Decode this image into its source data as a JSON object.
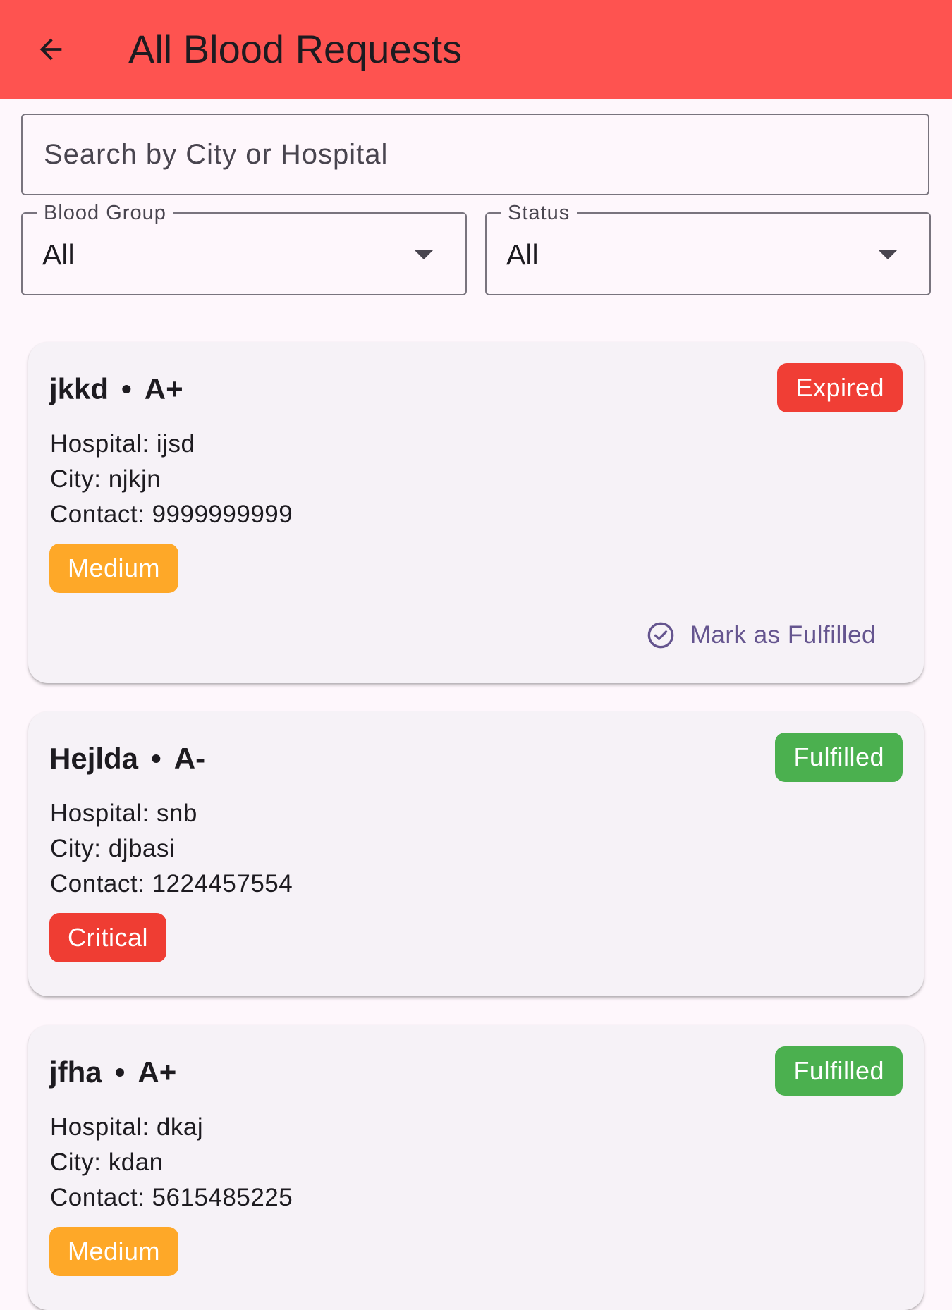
{
  "appbar": {
    "title": "All Blood Requests",
    "back_icon": "arrow-back-icon"
  },
  "colors": {
    "appbar": "#fe5350",
    "expired": "#f03e35",
    "fulfilled": "#4bb04f",
    "critical": "#ef3d33",
    "medium": "#fea828",
    "action": "#65558f"
  },
  "search": {
    "placeholder": "Search by City or Hospital",
    "value": ""
  },
  "filters": {
    "blood_group": {
      "label": "Blood Group",
      "value": "All"
    },
    "status": {
      "label": "Status",
      "value": "All"
    }
  },
  "requests": [
    {
      "name": "jkkd",
      "separator": "•",
      "blood_group": "A+",
      "status": "Expired",
      "hospital": "Hospital: ijsd",
      "city": "City: njkjn",
      "contact": "Contact: 9999999999",
      "urgency": "Medium",
      "action_label": "Mark as Fulfilled",
      "action_icon": "check-circle-icon"
    },
    {
      "name": "Hejlda",
      "separator": "•",
      "blood_group": "A-",
      "status": "Fulfilled",
      "hospital": "Hospital: snb",
      "city": "City: djbasi",
      "contact": "Contact: 1224457554",
      "urgency": "Critical"
    },
    {
      "name": "jfha",
      "separator": "•",
      "blood_group": "A+",
      "status": "Fulfilled",
      "hospital": "Hospital: dkaj",
      "city": "City: kdan",
      "contact": "Contact: 5615485225",
      "urgency": "Medium"
    }
  ]
}
